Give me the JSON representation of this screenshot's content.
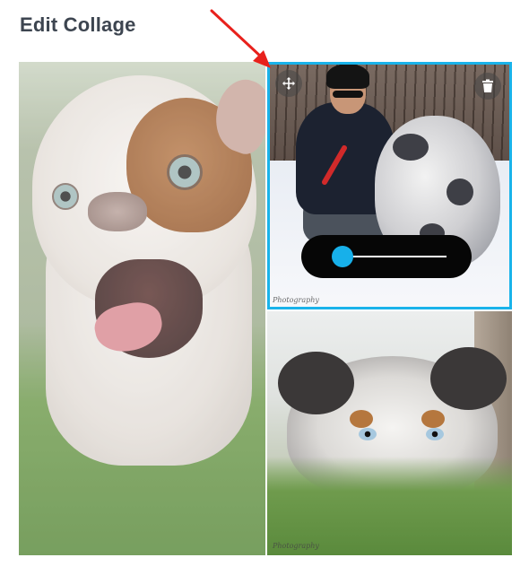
{
  "header": {
    "title": "Edit Collage"
  },
  "collage": {
    "cells": [
      {
        "name": "bulldog photo"
      },
      {
        "name": "man with puppy in snow photo",
        "selected": true,
        "watermark": "Photography"
      },
      {
        "name": "australian shepherd in grass photo",
        "watermark": "Photography"
      }
    ],
    "controls": {
      "move_icon": "move-icon",
      "delete_icon": "trash-icon",
      "zoom_level": 0.05
    }
  },
  "colors": {
    "accent": "#19b3ea",
    "title": "#3d4550",
    "slider_bg": "#060606",
    "annotation_arrow": "#e8211c"
  }
}
